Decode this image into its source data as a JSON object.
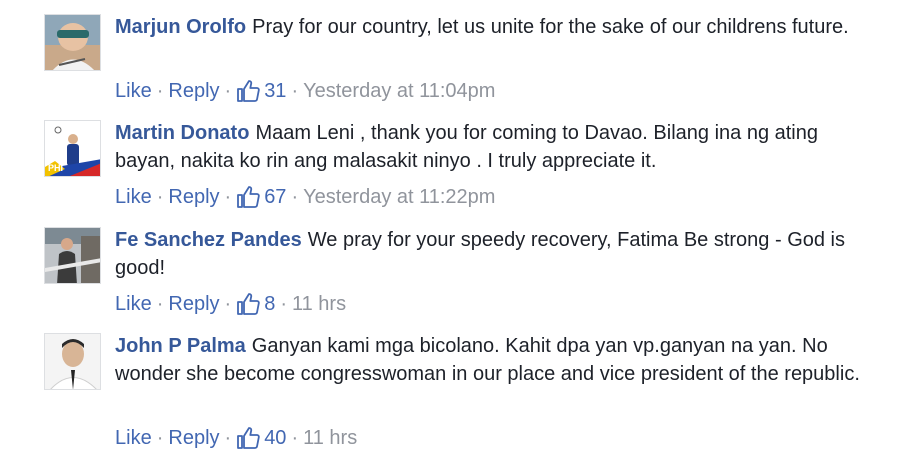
{
  "comments": [
    {
      "author": "Marjun Orolfo",
      "text": "Pray for our country, let us unite for the sake of our childrens future.",
      "like_label": "Like",
      "reply_label": "Reply",
      "like_count": "31",
      "timestamp": "Yesterday at 11:04pm"
    },
    {
      "author": "Martin Donato",
      "text": "Maam Leni , thank you for coming to Davao. Bilang ina ng ating bayan, nakita ko rin ang malasakit ninyo . I truly appreciate it.",
      "like_label": "Like",
      "reply_label": "Reply",
      "like_count": "67",
      "timestamp": "Yesterday at 11:22pm",
      "avatar_badge": "PHI"
    },
    {
      "author": "Fe Sanchez Pandes",
      "text": "We pray for your speedy recovery, Fatima Be strong - God is good!",
      "like_label": "Like",
      "reply_label": "Reply",
      "like_count": "8",
      "timestamp": "11 hrs"
    },
    {
      "author": "John P Palma",
      "text": "Ganyan kami mga bicolano. Kahit dpa yan vp.ganyan na yan. No wonder she become congresswoman in our place and vice president of the republic.",
      "like_label": "Like",
      "reply_label": "Reply",
      "like_count": "40",
      "timestamp": "11 hrs"
    }
  ],
  "separator": "·",
  "icons": {
    "like": "thumbs-up-icon"
  },
  "colors": {
    "author": "#365899",
    "link": "#4267b2",
    "meta": "#90949c",
    "text": "#1d2129"
  }
}
